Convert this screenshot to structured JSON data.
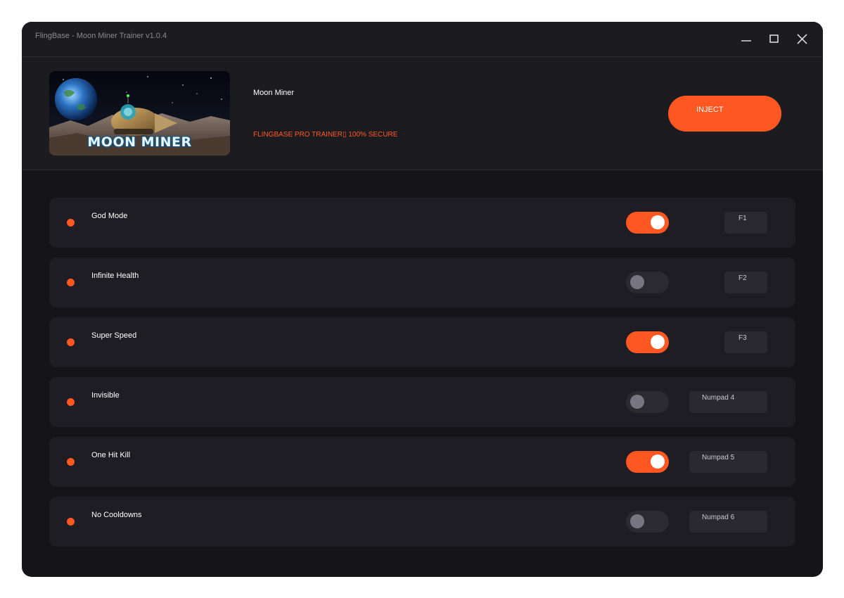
{
  "window": {
    "title": "FlingBase - Moon Miner Trainer v1.0.4",
    "controls": {
      "minimize": "minimize-icon",
      "maximize": "maximize-icon",
      "close": "close-icon"
    }
  },
  "header": {
    "cover_logo_text": "MOON MINER",
    "game_title": "Moon Miner",
    "subtitle": "FLINGBASE PRO TRAINER▯ 100% SECURE",
    "inject_label": "INJECT"
  },
  "colors": {
    "accent": "#ff5722",
    "window_bg": "#151419",
    "panel_bg": "#1c1b20",
    "row_bg": "#1e1d23"
  },
  "cheats": [
    {
      "label": "God Mode",
      "enabled": true,
      "hotkey": "F1"
    },
    {
      "label": "Infinite Health",
      "enabled": false,
      "hotkey": "F2"
    },
    {
      "label": "Super Speed",
      "enabled": true,
      "hotkey": "F3"
    },
    {
      "label": "Invisible",
      "enabled": false,
      "hotkey": "Numpad 4"
    },
    {
      "label": "One Hit Kill",
      "enabled": true,
      "hotkey": "Numpad 5"
    },
    {
      "label": "No Cooldowns",
      "enabled": false,
      "hotkey": "Numpad 6"
    }
  ]
}
